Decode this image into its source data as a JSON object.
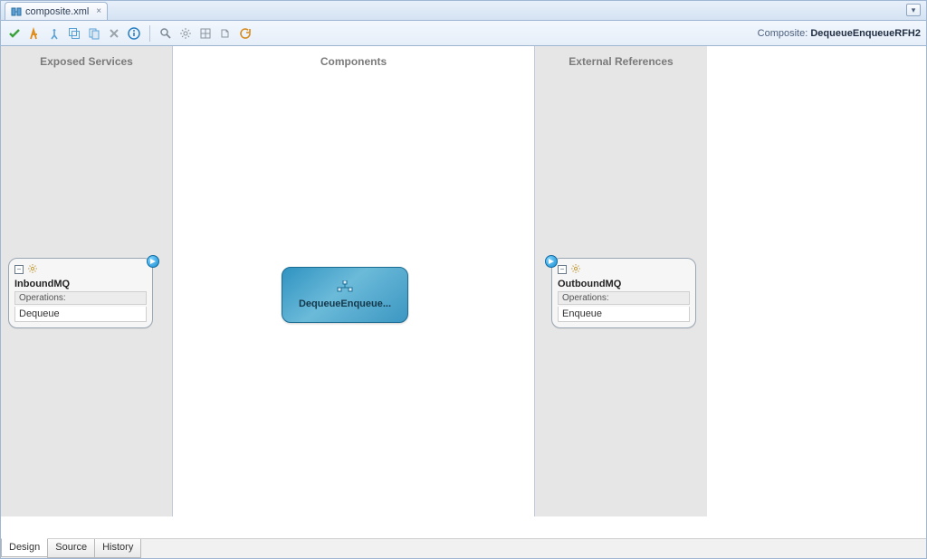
{
  "tabs": {
    "file_name": "composite.xml",
    "menu_glyph": "▾"
  },
  "toolbar": {
    "composite_label": "Composite:",
    "composite_name": "DequeueEnqueueRFH2"
  },
  "lanes": {
    "left_header": "Exposed Services",
    "center_header": "Components",
    "right_header": "External References"
  },
  "service_left": {
    "title": "InboundMQ",
    "ops_label": "Operations:",
    "ops": [
      "Dequeue"
    ]
  },
  "component": {
    "label": "DequeueEnqueue..."
  },
  "service_right": {
    "title": "OutboundMQ",
    "ops_label": "Operations:",
    "ops": [
      "Enqueue"
    ]
  },
  "bottom_tabs": [
    "Design",
    "Source",
    "History"
  ],
  "colors": {
    "frame_border": "#a0b7d4",
    "lane_side_bg": "#e6e6e6",
    "component_bg_from": "#2f93c1",
    "component_bg_to": "#6bbad9"
  }
}
